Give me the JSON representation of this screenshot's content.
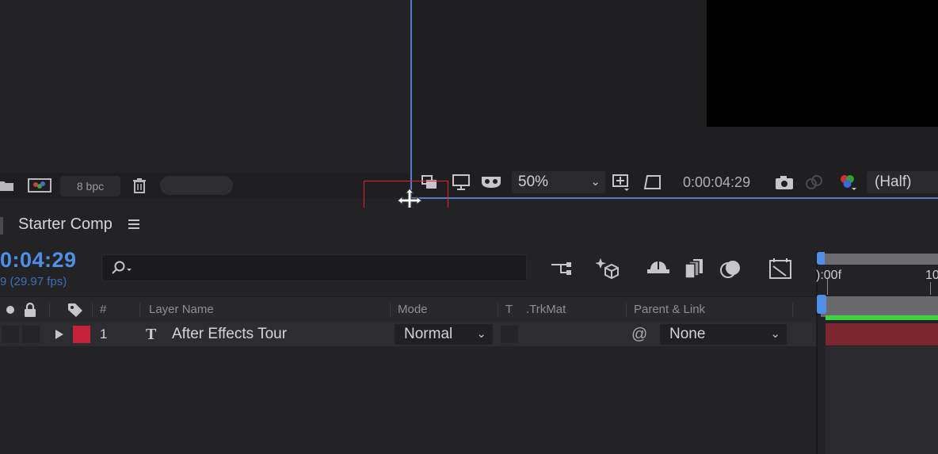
{
  "project_panel": {
    "bpc_label": "8 bpc"
  },
  "viewer": {
    "zoom_value": "50%",
    "timecode": "0:00:04:29",
    "resolution_value": "(Half)"
  },
  "timeline": {
    "comp_tab_label": "Starter Comp",
    "current_time": "0:04:29",
    "frame_readout": "9 (29.97 fps)",
    "columns": {
      "number": "#",
      "layer_name": "Layer Name",
      "mode": "Mode",
      "t": "T",
      "trkmat": ".TrkMat",
      "parent": "Parent & Link"
    },
    "ruler": {
      "start_label": "):00f",
      "next_label": "10"
    },
    "layer": {
      "number": "1",
      "type_icon": "T",
      "name": "After Effects Tour",
      "mode": "Normal",
      "parent": "None",
      "label_color": "#c4213c"
    }
  },
  "colors": {
    "accent_blue": "#4f8fe8",
    "highlight_red": "#e0222a",
    "green_bar": "#3fd43f"
  }
}
